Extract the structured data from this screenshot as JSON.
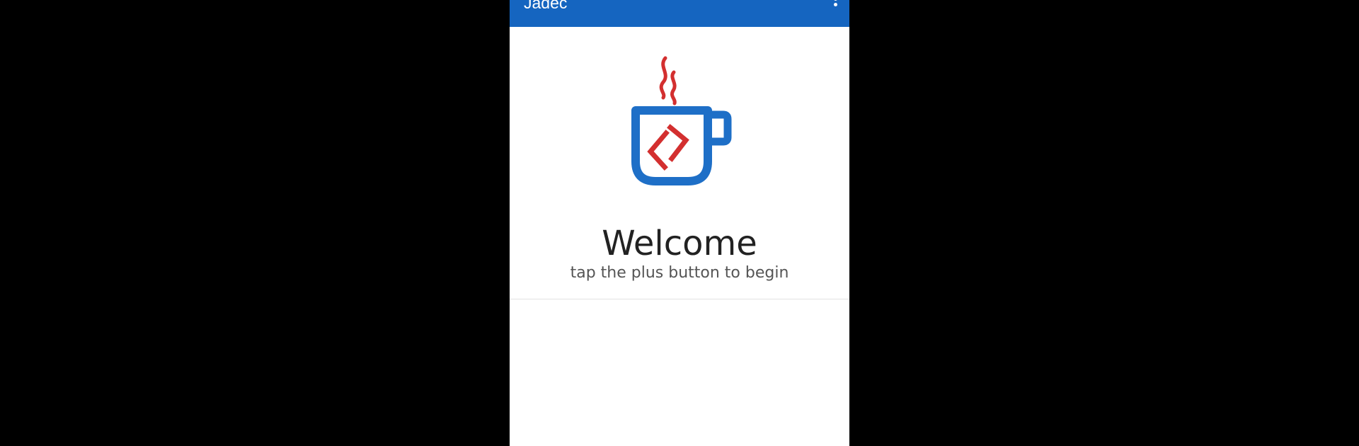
{
  "app": {
    "title": "Jadec"
  },
  "toolbar": {
    "overflow_icon": "more-vert-icon"
  },
  "logo": {
    "icon": "coffee-cup-code-icon",
    "cup_color": "#1e6fc7",
    "accent_color": "#d32f2f"
  },
  "welcome": {
    "title": "Welcome",
    "subtitle": "tap the plus button to begin"
  },
  "colors": {
    "appbar": "#1565c0",
    "background": "#000000",
    "surface": "#ffffff"
  }
}
